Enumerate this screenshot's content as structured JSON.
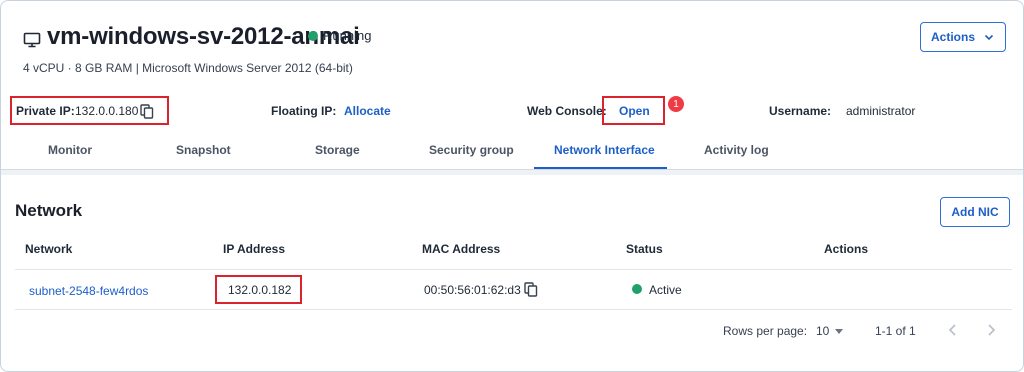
{
  "header": {
    "vm_name": "vm-windows-sv-2012-anmai",
    "status": "Running",
    "specs": "4 vCPU · 8 GB RAM | Microsoft Windows Server 2012 (64-bit)",
    "actions_label": "Actions"
  },
  "info": {
    "private_ip_label": "Private IP:",
    "private_ip_value": "132.0.0.180",
    "floating_ip_label": "Floating IP:",
    "floating_ip_link": "Allocate",
    "web_console_label": "Web Console:",
    "web_console_link": "Open",
    "badge": "1",
    "username_label": "Username:",
    "username_value": "administrator"
  },
  "tabs": [
    {
      "label": "Monitor"
    },
    {
      "label": "Snapshot"
    },
    {
      "label": "Storage"
    },
    {
      "label": "Security group"
    },
    {
      "label": "Network Interface",
      "active": true
    },
    {
      "label": "Activity log"
    }
  ],
  "network": {
    "title": "Network",
    "add_label": "Add NIC",
    "columns": [
      "Network",
      "IP Address",
      "MAC Address",
      "Status",
      "Actions"
    ],
    "rows": [
      {
        "network": "subnet-2548-few4rdos",
        "ip": "132.0.0.182",
        "mac": "00:50:56:01:62:d3",
        "status": "Active"
      }
    ]
  },
  "pagination": {
    "rows_label": "Rows per page:",
    "rows_value": "10",
    "range": "1-1 of 1"
  },
  "colors": {
    "accent": "#1d5fc9",
    "status_green": "#22a06b",
    "highlight_red": "#d9232d"
  },
  "icons": [
    "monitor-icon",
    "copy-icon",
    "chevron-down-icon",
    "chevron-left-icon",
    "chevron-right-icon"
  ]
}
